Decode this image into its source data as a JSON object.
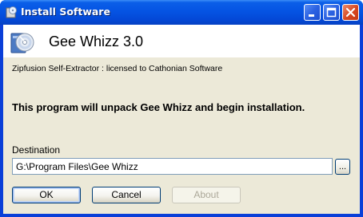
{
  "window": {
    "title": "Install Software",
    "buttons": {
      "minimize": "minimize-icon",
      "maximize": "maximize-icon",
      "close": "close-icon"
    }
  },
  "header": {
    "app_name": "Gee Whizz 3.0",
    "icon": "installer-cd-icon"
  },
  "subtitle": "Zipfusion Self-Extractor : licensed to Cathonian Software",
  "message": "This program will unpack Gee Whizz and begin installation.",
  "destination": {
    "label": "Destination",
    "value": "G:\\Program Files\\Gee Whizz",
    "browse_label": "..."
  },
  "actions": {
    "ok_label": "OK",
    "cancel_label": "Cancel",
    "about_label": "About",
    "about_enabled": false
  },
  "colors": {
    "titlebar": "#0554e3",
    "client_bg": "#ece9d8",
    "close_button": "#d6461f"
  }
}
